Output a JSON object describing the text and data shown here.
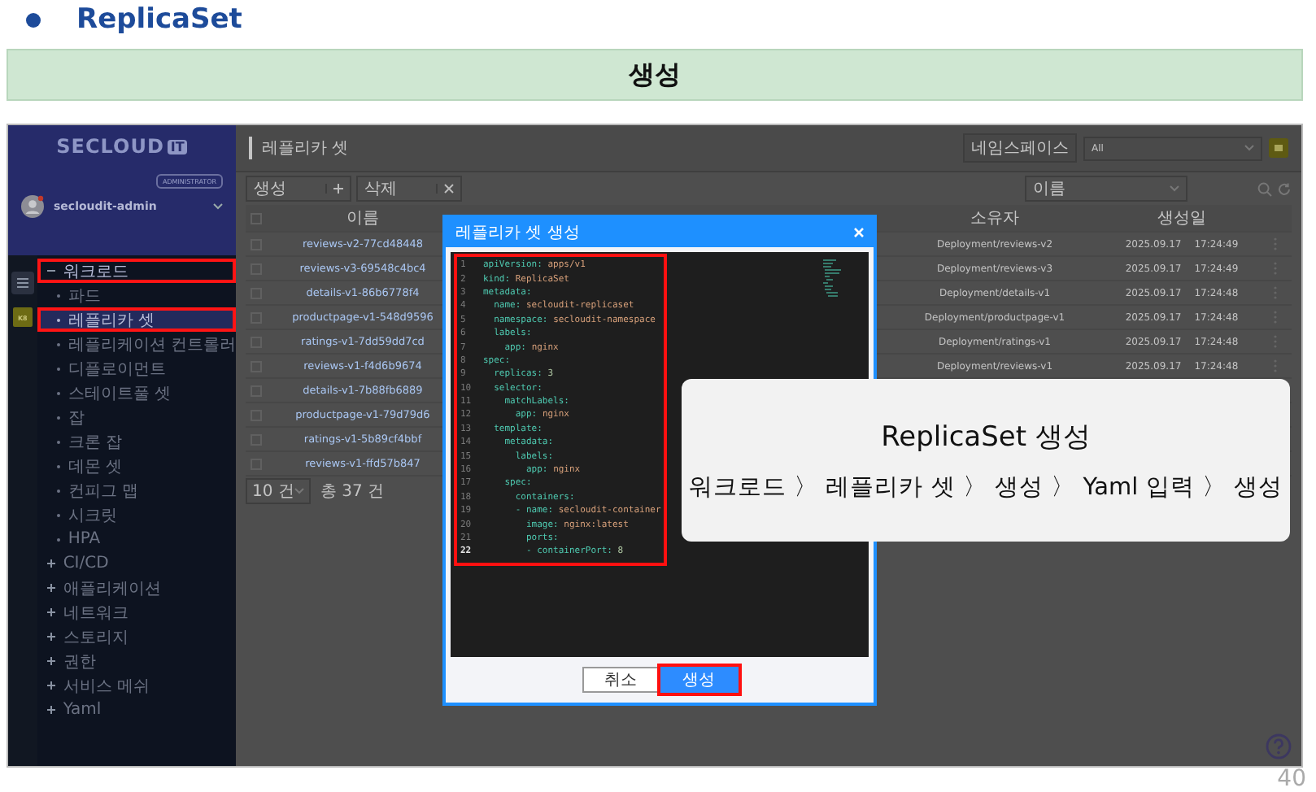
{
  "slide": {
    "heading": "ReplicaSet",
    "banner": "생성",
    "page": "40"
  },
  "sidebar": {
    "logo": {
      "text": "SECLOUD",
      "badge": "IT"
    },
    "user": {
      "role": "ADMINISTRATOR",
      "name": "secloudit-admin"
    },
    "rail_badge": "K8",
    "items": [
      {
        "label": "워크로드",
        "expanded": true,
        "selected": false,
        "highlighted": true,
        "children": [
          {
            "label": "파드",
            "selected": false,
            "highlighted": false
          },
          {
            "label": "레플리카 셋",
            "selected": true,
            "highlighted": true
          },
          {
            "label": "레플리케이션 컨트롤러",
            "selected": false,
            "highlighted": false
          },
          {
            "label": "디플로이먼트",
            "selected": false,
            "highlighted": false
          },
          {
            "label": "스테이트풀 셋",
            "selected": false,
            "highlighted": false
          },
          {
            "label": "잡",
            "selected": false,
            "highlighted": false
          },
          {
            "label": "크론 잡",
            "selected": false,
            "highlighted": false
          },
          {
            "label": "데몬 셋",
            "selected": false,
            "highlighted": false
          },
          {
            "label": "컨피그 맵",
            "selected": false,
            "highlighted": false
          },
          {
            "label": "시크릿",
            "selected": false,
            "highlighted": false
          },
          {
            "label": "HPA",
            "selected": false,
            "highlighted": false
          }
        ]
      },
      {
        "label": "CI/CD",
        "expanded": false,
        "selected": false,
        "highlighted": false
      },
      {
        "label": "애플리케이션",
        "expanded": false,
        "selected": false,
        "highlighted": false
      },
      {
        "label": "네트워크",
        "expanded": false,
        "selected": false,
        "highlighted": false
      },
      {
        "label": "스토리지",
        "expanded": false,
        "selected": false,
        "highlighted": false
      },
      {
        "label": "권한",
        "expanded": false,
        "selected": false,
        "highlighted": false
      },
      {
        "label": "서비스 메쉬",
        "expanded": false,
        "selected": false,
        "highlighted": false
      },
      {
        "label": "Yaml",
        "expanded": false,
        "selected": false,
        "highlighted": false
      }
    ]
  },
  "main": {
    "title": "레플리카 셋",
    "namespace": {
      "label": "네임스페이스",
      "value": "All"
    },
    "toolbar": [
      {
        "label": "생성"
      },
      {
        "label": "삭제"
      }
    ],
    "search": {
      "field": "이름"
    },
    "table": {
      "columns": [
        "이름",
        "소유자",
        "생성일"
      ],
      "all_checked": false,
      "rows": [
        {
          "checked": false,
          "name": "reviews-v2-77cd48448",
          "owner": "Deployment/reviews-v2",
          "date": "2025.09.17",
          "time": "17:24:49"
        },
        {
          "checked": false,
          "name": "reviews-v3-69548c4bc4",
          "owner": "Deployment/reviews-v3",
          "date": "2025.09.17",
          "time": "17:24:49"
        },
        {
          "checked": false,
          "name": "details-v1-86b6778f4",
          "owner": "Deployment/details-v1",
          "date": "2025.09.17",
          "time": "17:24:48"
        },
        {
          "checked": false,
          "name": "productpage-v1-548d9596",
          "owner": "Deployment/productpage-v1",
          "date": "2025.09.17",
          "time": "17:24:48"
        },
        {
          "checked": false,
          "name": "ratings-v1-7dd59dd7cd",
          "owner": "Deployment/ratings-v1",
          "date": "2025.09.17",
          "time": "17:24:48"
        },
        {
          "checked": false,
          "name": "reviews-v1-f4d6b9674",
          "owner": "Deployment/reviews-v1",
          "date": "2025.09.17",
          "time": "17:24:48"
        },
        {
          "checked": false,
          "name": "details-v1-7b88fb6889"
        },
        {
          "checked": false,
          "name": "productpage-v1-79d79d6"
        },
        {
          "checked": false,
          "name": "ratings-v1-5b89cf4bbf"
        },
        {
          "checked": false,
          "name": "reviews-v1-ffd57b847"
        }
      ]
    },
    "footer": {
      "page_size": "10 건",
      "total": "총 37 건"
    }
  },
  "dialog": {
    "title": "레플리카 셋 생성",
    "code_highlighted": true,
    "lines": [
      {
        "num": "1",
        "key": "apiVersion:",
        "value": "apps/v1",
        "kind": "string",
        "current": false
      },
      {
        "num": "2",
        "key": "kind:",
        "value": "ReplicaSet",
        "kind": "string",
        "current": false
      },
      {
        "num": "3",
        "key": "metadata:",
        "kind": "key",
        "current": false
      },
      {
        "num": "4",
        "key": "  name:",
        "value": "secloudit-replicaset",
        "kind": "string",
        "current": false
      },
      {
        "num": "5",
        "key": "  namespace:",
        "value": "secloudit-namespace",
        "kind": "string",
        "current": false
      },
      {
        "num": "6",
        "key": "  labels:",
        "kind": "key",
        "current": false
      },
      {
        "num": "7",
        "key": "    app:",
        "value": "nginx",
        "kind": "string",
        "current": false
      },
      {
        "num": "8",
        "key": "spec:",
        "kind": "key",
        "current": false
      },
      {
        "num": "9",
        "key": "  replicas:",
        "value": "3",
        "kind": "number",
        "current": false
      },
      {
        "num": "10",
        "key": "  selector:",
        "kind": "key",
        "current": false
      },
      {
        "num": "11",
        "key": "    matchLabels:",
        "kind": "key",
        "current": false
      },
      {
        "num": "12",
        "key": "      app:",
        "value": "nginx",
        "kind": "string",
        "current": false
      },
      {
        "num": "13",
        "key": "  template:",
        "kind": "key",
        "current": false
      },
      {
        "num": "14",
        "key": "    metadata:",
        "kind": "key",
        "current": false
      },
      {
        "num": "15",
        "key": "      labels:",
        "kind": "key",
        "current": false
      },
      {
        "num": "16",
        "key": "        app:",
        "value": "nginx",
        "kind": "string",
        "current": false
      },
      {
        "num": "17",
        "key": "    spec:",
        "kind": "key",
        "current": false
      },
      {
        "num": "18",
        "key": "      containers:",
        "kind": "key",
        "current": false
      },
      {
        "num": "19",
        "key": "      - name:",
        "value": "secloudit-container",
        "kind": "string",
        "current": false
      },
      {
        "num": "20",
        "key": "        image:",
        "value": "nginx:latest",
        "kind": "string",
        "current": false
      },
      {
        "num": "21",
        "key": "        ports:",
        "kind": "key",
        "current": false
      },
      {
        "num": "22",
        "key": "        - containerPort:",
        "value": "8",
        "kind": "number",
        "current": true
      }
    ],
    "buttons": [
      {
        "label": "취소",
        "kind": "secondary",
        "highlighted": false
      },
      {
        "label": "생성",
        "kind": "primary",
        "highlighted": true
      }
    ]
  },
  "callout": {
    "title": "ReplicaSet 생성",
    "path": "워크로드 〉 레플리카 셋 〉 생성 〉 Yaml 입력 〉 생성"
  }
}
